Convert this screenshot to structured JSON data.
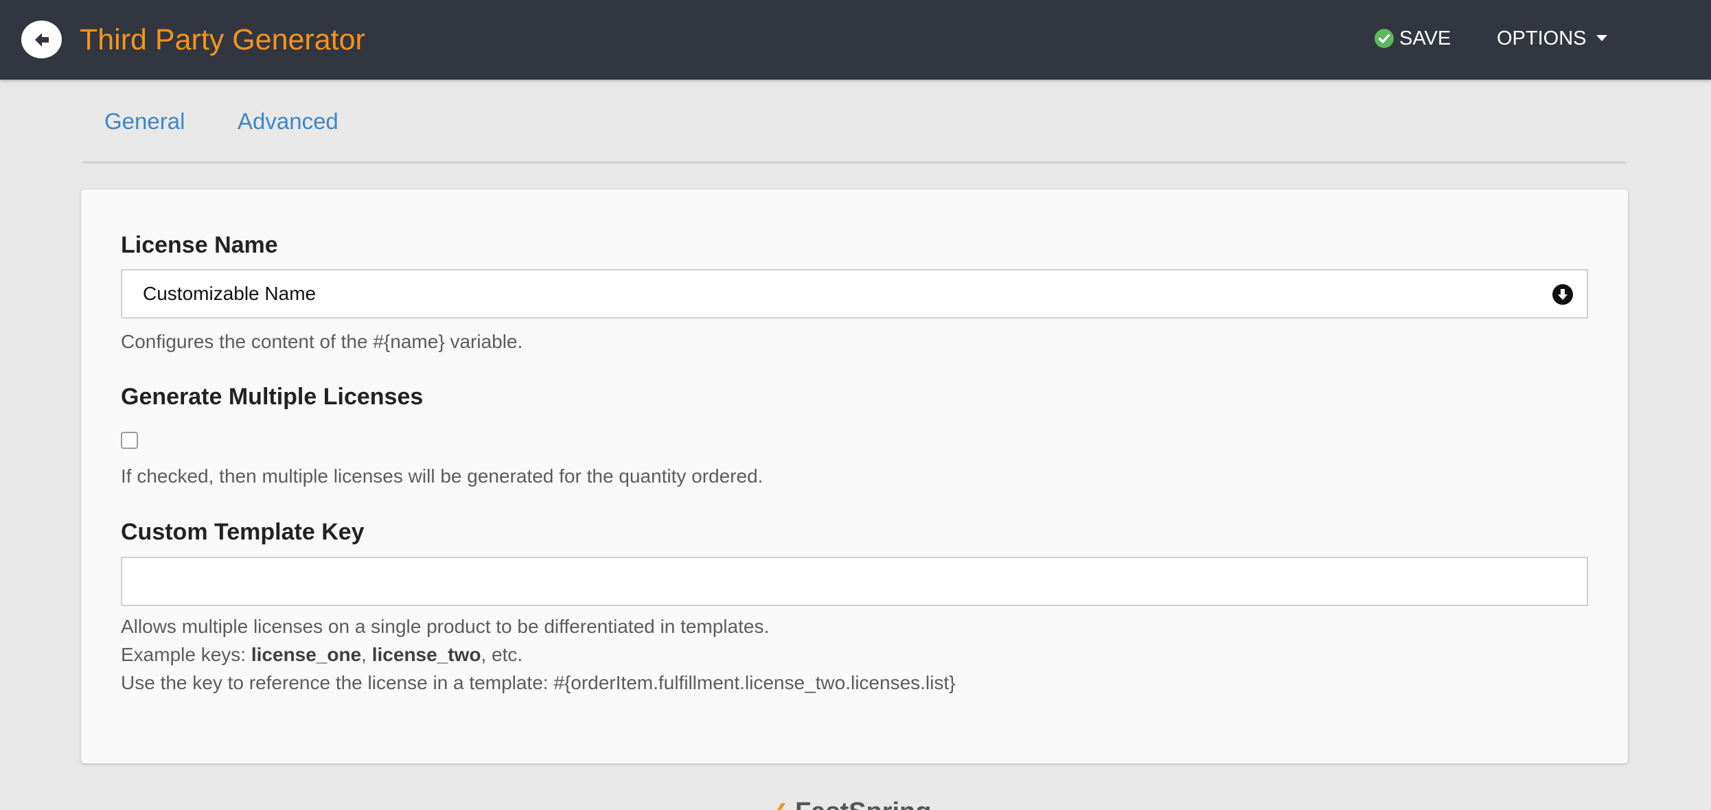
{
  "header": {
    "title": "Third Party Generator",
    "back_icon": "arrow-left-icon",
    "save_label": "SAVE",
    "save_icon": "check-circle-icon",
    "options_label": "OPTIONS",
    "options_icon": "caret-down-icon"
  },
  "tabs": [
    {
      "label": "General"
    },
    {
      "label": "Advanced"
    }
  ],
  "form": {
    "license_name": {
      "label": "License Name",
      "value": "Customizable Name",
      "icon": "circle-arrow-down-icon",
      "help": "Configures the content of the #{name} variable."
    },
    "multiple_licenses": {
      "label": "Generate Multiple Licenses",
      "checked": false,
      "help": "If checked, then multiple licenses will be generated for the quantity ordered."
    },
    "template_key": {
      "label": "Custom Template Key",
      "value": "",
      "help_line1": "Allows multiple licenses on a single product to be differentiated in templates.",
      "help_line2_prefix": "Example keys: ",
      "help_line2_key1": "license_one",
      "help_line2_sep": ", ",
      "help_line2_key2": "license_two",
      "help_line2_suffix": ", etc.",
      "help_line3": "Use the key to reference the license in a template: #{orderItem.fulfillment.license_two.licenses.list}"
    }
  },
  "footer": {
    "logo_text": "FastSpring"
  },
  "colors": {
    "topbar": "#323640",
    "title": "#f7941d",
    "tab": "#3b87c8",
    "save_check": "#5cb85c",
    "page_bg": "#e8e8e8"
  }
}
